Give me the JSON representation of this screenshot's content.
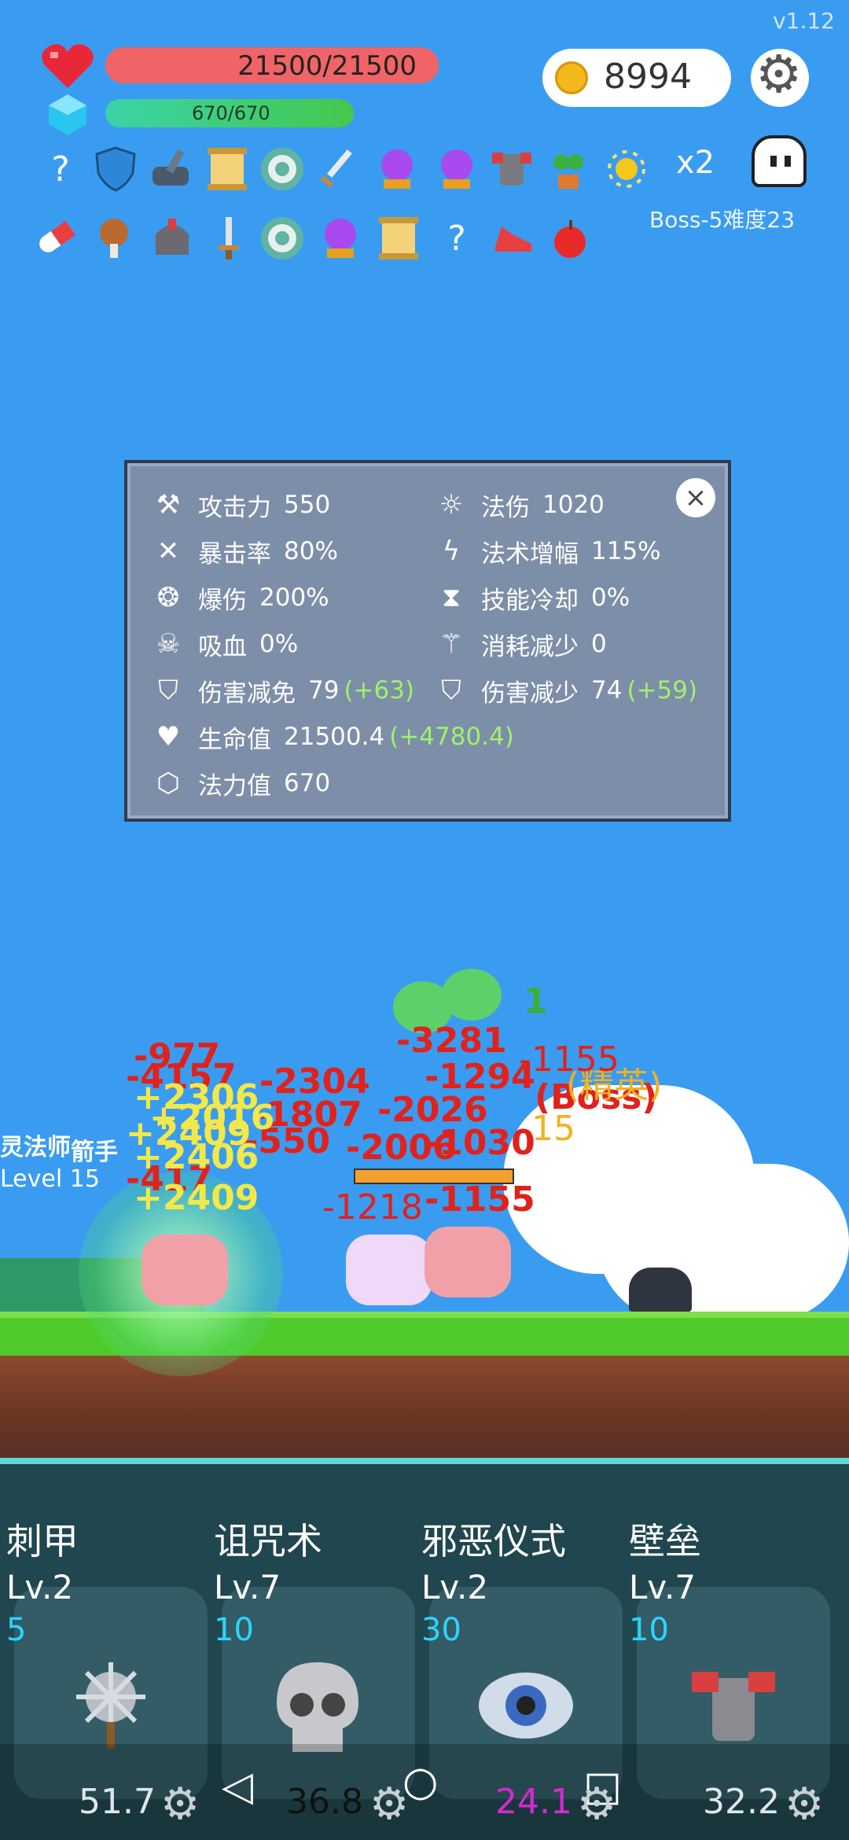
{
  "version": "v1.12",
  "hud": {
    "hp": "21500/21500",
    "mp": "670/670",
    "coins": "8994",
    "multiplier": "x2",
    "stage": "Boss-5难度23"
  },
  "items_row1": [
    "question-icon",
    "shield-icon",
    "mortar-icon",
    "scroll-icon",
    "target-icon",
    "sword-icon",
    "crystal-ball-icon",
    "crystal-ball-icon",
    "armor-icon",
    "plant-icon",
    "sun-icon"
  ],
  "items_row2": [
    "pill-icon",
    "meat-icon",
    "helmet-icon",
    "dagger-icon",
    "target-icon",
    "crystal-ball-icon",
    "scroll-icon",
    "question-icon",
    "shoe-icon",
    "apple-icon"
  ],
  "stats": {
    "left": [
      {
        "icon": "axe-icon",
        "label": "攻击力",
        "value": "550",
        "bonus": ""
      },
      {
        "icon": "crosshair-icon",
        "label": "暴击率",
        "value": "80%",
        "bonus": ""
      },
      {
        "icon": "burst-icon",
        "label": "爆伤",
        "value": "200%",
        "bonus": ""
      },
      {
        "icon": "skull-icon",
        "label": "吸血",
        "value": "0%",
        "bonus": ""
      },
      {
        "icon": "shield-icon",
        "label": "伤害减免",
        "value": "79",
        "bonus": "(+63)"
      },
      {
        "icon": "heart-icon",
        "label": "生命值",
        "value": "21500.4",
        "bonus": "(+4780.4)"
      },
      {
        "icon": "hexagon-icon",
        "label": "法力值",
        "value": "670",
        "bonus": ""
      }
    ],
    "right": [
      {
        "icon": "sun-icon",
        "label": "法伤",
        "value": "1020",
        "bonus": ""
      },
      {
        "icon": "lightning-icon",
        "label": "法术增幅",
        "value": "115%",
        "bonus": ""
      },
      {
        "icon": "hourglass-icon",
        "label": "技能冷却",
        "value": "0%",
        "bonus": ""
      },
      {
        "icon": "wand-icon",
        "label": "消耗减少",
        "value": "0",
        "bonus": ""
      },
      {
        "icon": "shield-icon",
        "label": "伤害减少",
        "value": "74",
        "bonus": "(+59)"
      }
    ],
    "close": "×"
  },
  "battle": {
    "damage_red": [
      "-977",
      "-4157",
      "-2304",
      "-1807",
      "-550",
      "-3281",
      "-1294",
      "-1155",
      "-1218",
      "-1155",
      "-417",
      "-2026",
      "-2006",
      "-1030"
    ],
    "damage_yellow": [
      "+2306",
      "+2016",
      "+2409",
      "+2406",
      "+2409",
      "15"
    ],
    "labels": [
      "灵法师",
      "箭手",
      "Level 15",
      "(Boss)",
      "(精英)"
    ],
    "green": [
      "1"
    ]
  },
  "skills": [
    {
      "name": "刺甲",
      "level": "Lv.2",
      "cost": "5",
      "cooldown": "51.7",
      "icon": "spiked-mace-icon",
      "cost_color": "#2ad6ff",
      "cd_color": "#dfe6e8"
    },
    {
      "name": "诅咒术",
      "level": "Lv.7",
      "cost": "10",
      "cooldown": "36.8",
      "icon": "skull-icon",
      "cost_color": "#2ad6ff",
      "cd_color": "#111111"
    },
    {
      "name": "邪恶仪式",
      "level": "Lv.2",
      "cost": "30",
      "cooldown": "24.1",
      "icon": "eye-icon",
      "cost_color": "#2ad6ff",
      "cd_color": "#d22ad2"
    },
    {
      "name": "壁垒",
      "level": "Lv.7",
      "cost": "10",
      "cooldown": "32.2",
      "icon": "armor-icon",
      "cost_color": "#2ad6ff",
      "cd_color": "#dfe6e8"
    }
  ],
  "nav": {
    "back": "◁",
    "home": "○",
    "recent": "□"
  }
}
